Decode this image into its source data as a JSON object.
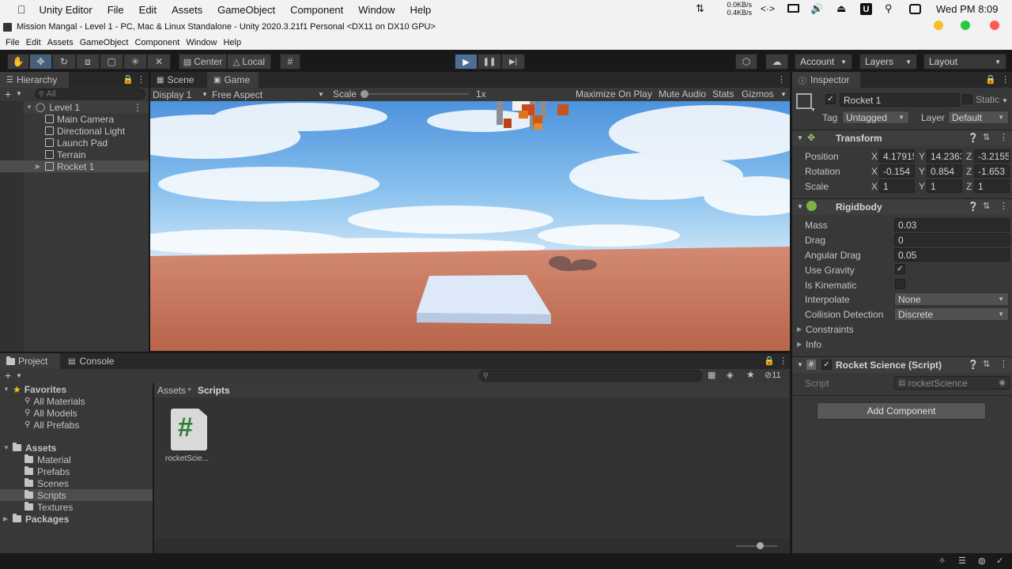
{
  "mac_menu": {
    "app": "Unity Editor",
    "items": [
      "File",
      "Edit",
      "Assets",
      "GameObject",
      "Component",
      "Window",
      "Help"
    ],
    "net_up": "0.0KB/s",
    "net_down": "0.4KB/s",
    "clock": "Wed PM 8:09"
  },
  "window": {
    "title": "Mission Mangal - Level 1 - PC, Mac & Linux Standalone - Unity 2020.3.21f1 Personal <DX11 on DX10 GPU>",
    "menu": [
      "File",
      "Edit",
      "Assets",
      "GameObject",
      "Component",
      "Window",
      "Help"
    ]
  },
  "toolbar": {
    "pivot": "Center",
    "space": "Local",
    "account": "Account",
    "layers": "Layers",
    "layout": "Layout"
  },
  "hierarchy": {
    "tab": "Hierarchy",
    "search_placeholder": "All",
    "scene": "Level 1",
    "items": [
      "Main Camera",
      "Directional Light",
      "Launch Pad",
      "Terrain",
      "Rocket 1"
    ]
  },
  "game": {
    "tabs": [
      "Scene",
      "Game"
    ],
    "display": "Display 1",
    "aspect": "Free Aspect",
    "scale_label": "Scale",
    "scale_value": "1x",
    "maximize": "Maximize On Play",
    "mute": "Mute Audio",
    "stats": "Stats",
    "gizmos": "Gizmos",
    "scale_slider": 0.0
  },
  "project": {
    "tabs": [
      "Project",
      "Console"
    ],
    "hidden_count": "11",
    "favorites_label": "Favorites",
    "favorites": [
      "All Materials",
      "All Models",
      "All Prefabs"
    ],
    "assets_label": "Assets",
    "folders": [
      "Material",
      "Prefabs",
      "Scenes",
      "Scripts",
      "Textures"
    ],
    "packages_label": "Packages",
    "breadcrumb": [
      "Assets",
      "Scripts"
    ],
    "file_name": "rocketScie...",
    "file_glyph": "#"
  },
  "inspector": {
    "tab": "Inspector",
    "object_name": "Rocket 1",
    "static_label": "Static",
    "tag_label": "Tag",
    "tag": "Untagged",
    "layer_label": "Layer",
    "layer": "Default",
    "transform": {
      "title": "Transform",
      "rows": [
        {
          "label": "Position",
          "x": "4.17915",
          "y": "14.2363",
          "z": "-3.2155"
        },
        {
          "label": "Rotation",
          "x": "-0.154",
          "y": "0.854",
          "z": "-1.653"
        },
        {
          "label": "Scale",
          "x": "1",
          "y": "1",
          "z": "1"
        }
      ],
      "axis": [
        "X",
        "Y",
        "Z"
      ]
    },
    "rigidbody": {
      "title": "Rigidbody",
      "mass_label": "Mass",
      "mass": "0.03",
      "drag_label": "Drag",
      "drag": "0",
      "angular_label": "Angular Drag",
      "angular": "0.05",
      "gravity_label": "Use Gravity",
      "gravity": "✓",
      "kinematic_label": "Is Kinematic",
      "interpolate_label": "Interpolate",
      "interpolate": "None",
      "collision_label": "Collision Detection",
      "collision": "Discrete",
      "constraints": "Constraints",
      "info": "Info"
    },
    "script": {
      "title": "Rocket Science (Script)",
      "label": "Script",
      "value": "rocketScience"
    },
    "add_component": "Add Component"
  },
  "colors": {
    "play_active": "#46607c",
    "sky": "#79b8ee",
    "ground": "#cd7a63"
  }
}
